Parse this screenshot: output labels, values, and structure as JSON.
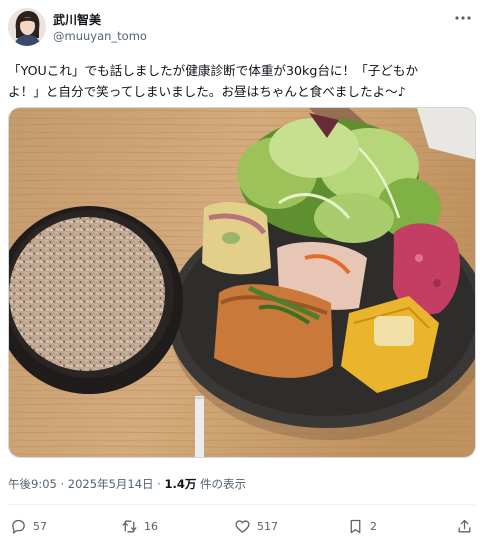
{
  "author": {
    "display_name": "武川智美",
    "handle": "@muuyan_tomo",
    "avatar_icon": "avatar-photo"
  },
  "tweet": {
    "text_line1": "「YOUこれ」でも話しましたが健康診断で体重が30kg台に！「子どもか",
    "text_line2": "よ！」と自分で笑ってしまいました。お昼はちゃんと食べましたよ〜♪"
  },
  "media": {
    "icon": "photo-plate-of-food"
  },
  "meta": {
    "time": "午後9:05",
    "separator": "·",
    "date": "2025年5月14日",
    "views_count": "1.4万",
    "views_label": " 件の表示"
  },
  "actions": {
    "reply_count": "57",
    "retweet_count": "16",
    "like_count": "517",
    "bookmark_count": "2"
  },
  "colors": {
    "text": "#0f1419",
    "secondary": "#536471",
    "divider": "#eff3f4"
  }
}
